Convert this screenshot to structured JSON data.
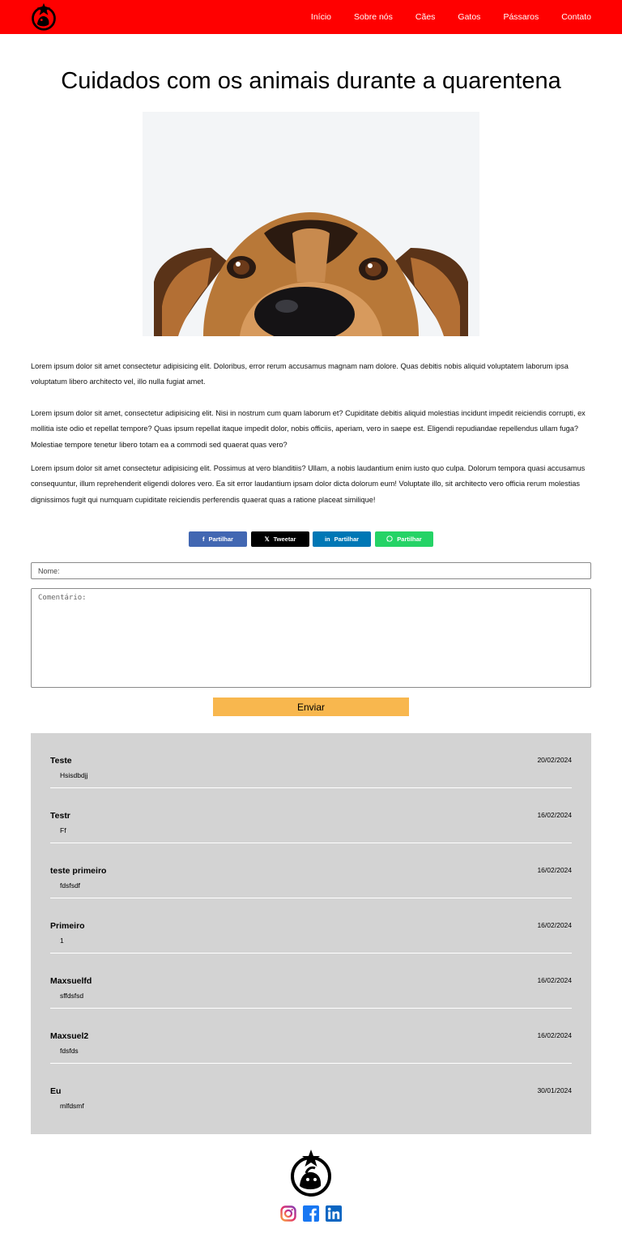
{
  "header": {
    "nav": [
      "Início",
      "Sobre nós",
      "Cães",
      "Gatos",
      "Pássaros",
      "Contato"
    ]
  },
  "article": {
    "title": "Cuidados com os animais durante a quarentena",
    "paragraphs": [
      "Lorem ipsum dolor sit amet consectetur adipisicing elit. Doloribus, error rerum accusamus magnam nam dolore. Quas debitis nobis aliquid voluptatem laborum ipsa voluptatum libero architecto vel, illo nulla fugiat amet.",
      "Lorem ipsum dolor sit amet, consectetur adipisicing elit. Nisi in nostrum cum quam laborum et? Cupiditate debitis aliquid molestias incidunt impedit reiciendis corrupti, ex mollitia iste odio et repellat tempore? Quas ipsum repellat itaque impedit dolor, nobis officiis, aperiam, vero in saepe est. Eligendi repudiandae repellendus ullam fuga? Molestiae tempore tenetur libero totam ea a commodi sed quaerat quas vero?",
      "Lorem ipsum dolor sit amet consectetur adipisicing elit. Possimus at vero blanditiis? Ullam, a nobis laudantium enim iusto quo culpa. Dolorum tempora quasi accusamus consequuntur, illum reprehenderit eligendi dolores vero. Ea sit error laudantium ipsam dolor dicta dolorum eum! Voluptate illo, sit architecto vero officia rerum molestias dignissimos fugit qui numquam cupiditate reiciendis perferendis quaerat quas a ratione placeat similique!"
    ]
  },
  "share": {
    "facebook": "Partilhar",
    "twitter": "Tweetar",
    "linkedin": "Partilhar",
    "whatsapp": "Partilhar",
    "colors": {
      "facebook": "#4267b2",
      "twitter": "#000000",
      "linkedin": "#0077b5",
      "whatsapp": "#25d366"
    }
  },
  "form": {
    "name_placeholder": "Nome:",
    "comment_placeholder": "Comentário:",
    "submit_label": "Enviar"
  },
  "comments": [
    {
      "name": "Teste",
      "date": "20/02/2024",
      "text": "Hsisdbdjj"
    },
    {
      "name": "Testr",
      "date": "16/02/2024",
      "text": "Ff"
    },
    {
      "name": "teste primeiro",
      "date": "16/02/2024",
      "text": "fdsfsdf"
    },
    {
      "name": "Primeiro",
      "date": "16/02/2024",
      "text": "1"
    },
    {
      "name": "Maxsuelfd",
      "date": "16/02/2024",
      "text": "sffdsfsd"
    },
    {
      "name": "Maxsuel2",
      "date": "16/02/2024",
      "text": "fdsfds"
    },
    {
      "name": "Eu",
      "date": "30/01/2024",
      "text": "mlfdsmf"
    }
  ],
  "footer": {
    "social_icons": [
      "instagram-icon",
      "facebook-icon",
      "linkedin-icon"
    ]
  },
  "theme": {
    "header_bg": "#ff0000",
    "button_bg": "#f8b74e",
    "comments_bg": "#d3d3d3"
  }
}
